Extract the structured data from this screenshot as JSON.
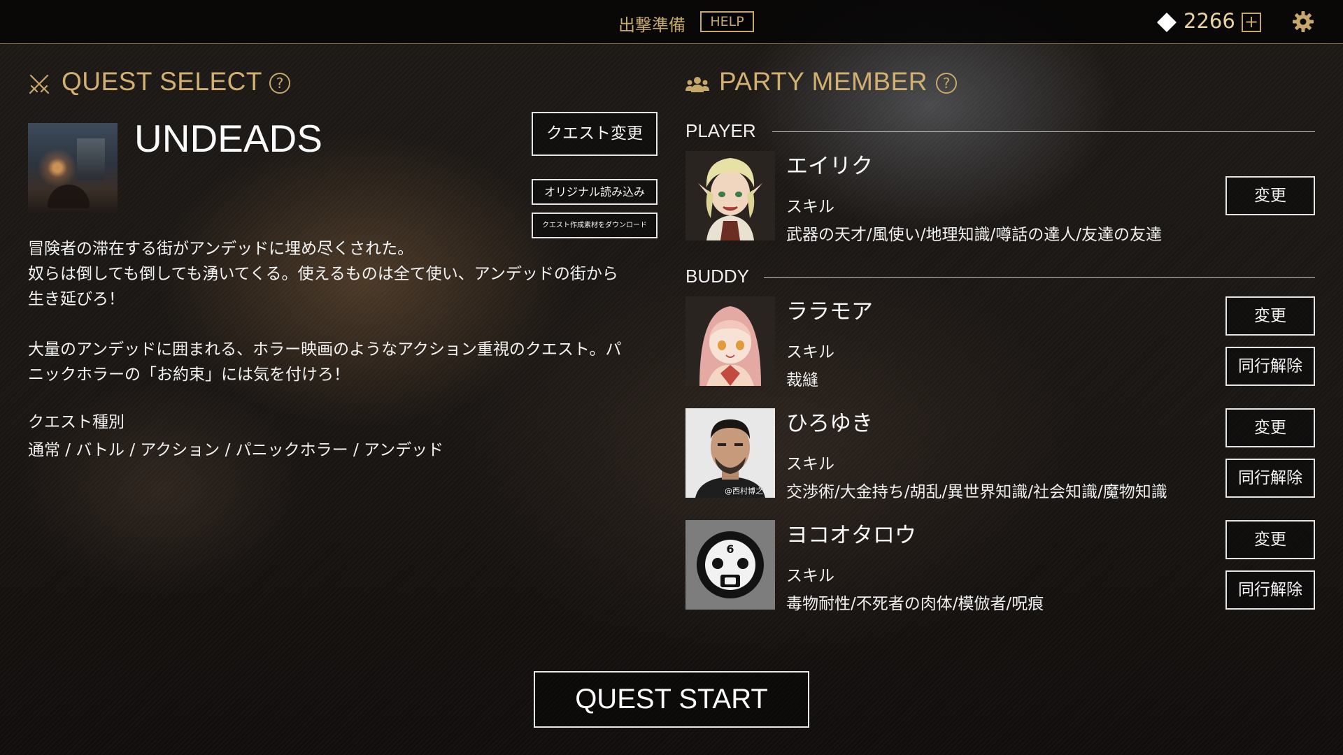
{
  "topbar": {
    "title": "出撃準備",
    "help_label": "HELP",
    "currency_icon": "diamond-gem-icon",
    "currency_count": "2266",
    "plus_label": "+",
    "settings_icon": "gear-icon"
  },
  "quest_select": {
    "heading": "QUEST SELECT",
    "help_mark": "?",
    "icon": "crossed-swords-icon",
    "quest_name": "UNDEADS",
    "change_label": "クエスト変更",
    "load_original_label": "オリジナル読み込み",
    "download_label": "クエスト作成素材をダウンロード",
    "description": [
      "冒険者の滞在する街がアンデッドに埋め尽くされた。",
      "奴らは倒しても倒しても湧いてくる。使えるものは全て使い、アンデッドの街から",
      "生き延びろ！",
      "",
      "大量のアンデッドに囲まれる、ホラー映画のようなアクション重視のクエスト。パ",
      "ニックホラーの「お約束」には気を付けろ！"
    ],
    "type_label": "クエスト種別",
    "type_value": "通常 / バトル / アクション / パニックホラー / アンデッド"
  },
  "party": {
    "heading": "PARTY MEMBER",
    "help_mark": "?",
    "icon": "group-icon",
    "player_label": "PLAYER",
    "buddy_label": "BUDDY",
    "skill_label": "スキル",
    "change_label": "変更",
    "dismiss_label": "同行解除",
    "player": {
      "name": "エイリク",
      "skills": "武器の天才/風使い/地理知識/噂話の達人/友達の友達"
    },
    "buddies": [
      {
        "name": "ララモア",
        "skills": "裁縫"
      },
      {
        "name": "ひろゆき",
        "skills": "交渉術/大金持ち/胡乱/異世界知識/社会知識/魔物知識",
        "credit": "@西村博之"
      },
      {
        "name": "ヨコオタロウ",
        "skills": "毒物耐性/不死者の肉体/模倣者/呪痕",
        "mask_number": "6"
      }
    ]
  },
  "start_label": "QUEST START"
}
